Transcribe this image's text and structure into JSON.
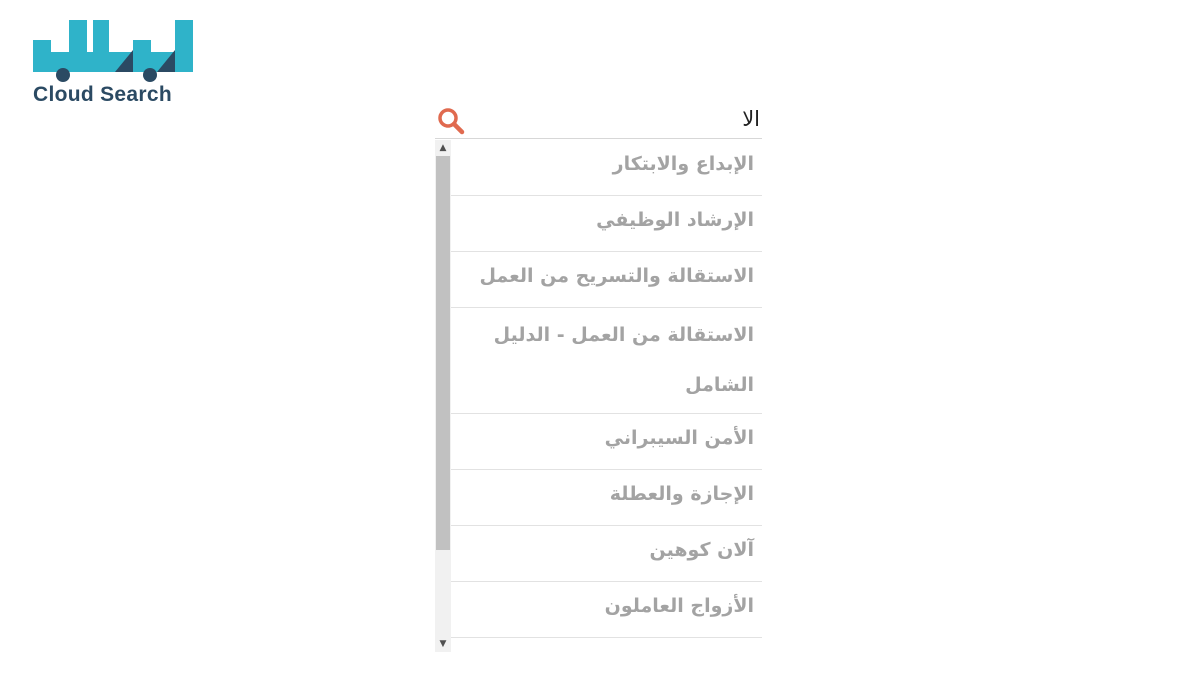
{
  "logo": {
    "text": "Cloud Search",
    "colors": {
      "teal": "#2fb3c9",
      "navy": "#2b4a63"
    },
    "icon": "lablab-logo-mark"
  },
  "search": {
    "value": "الا",
    "icon": "magnifier-icon",
    "icon_color": "#e06a4f"
  },
  "suggestions": [
    "الإبداع والابتكار",
    "الإرشاد الوظيفي",
    "الاستقالة والتسريح من العمل",
    "الاستقالة من العمل - الدليل الشامل",
    "الأمن السيبراني",
    "الإجازة والعطلة",
    "آلان كوهين",
    "الأزواج العاملون"
  ],
  "scrollbar": {
    "up_glyph": "▲",
    "down_glyph": "▼"
  }
}
